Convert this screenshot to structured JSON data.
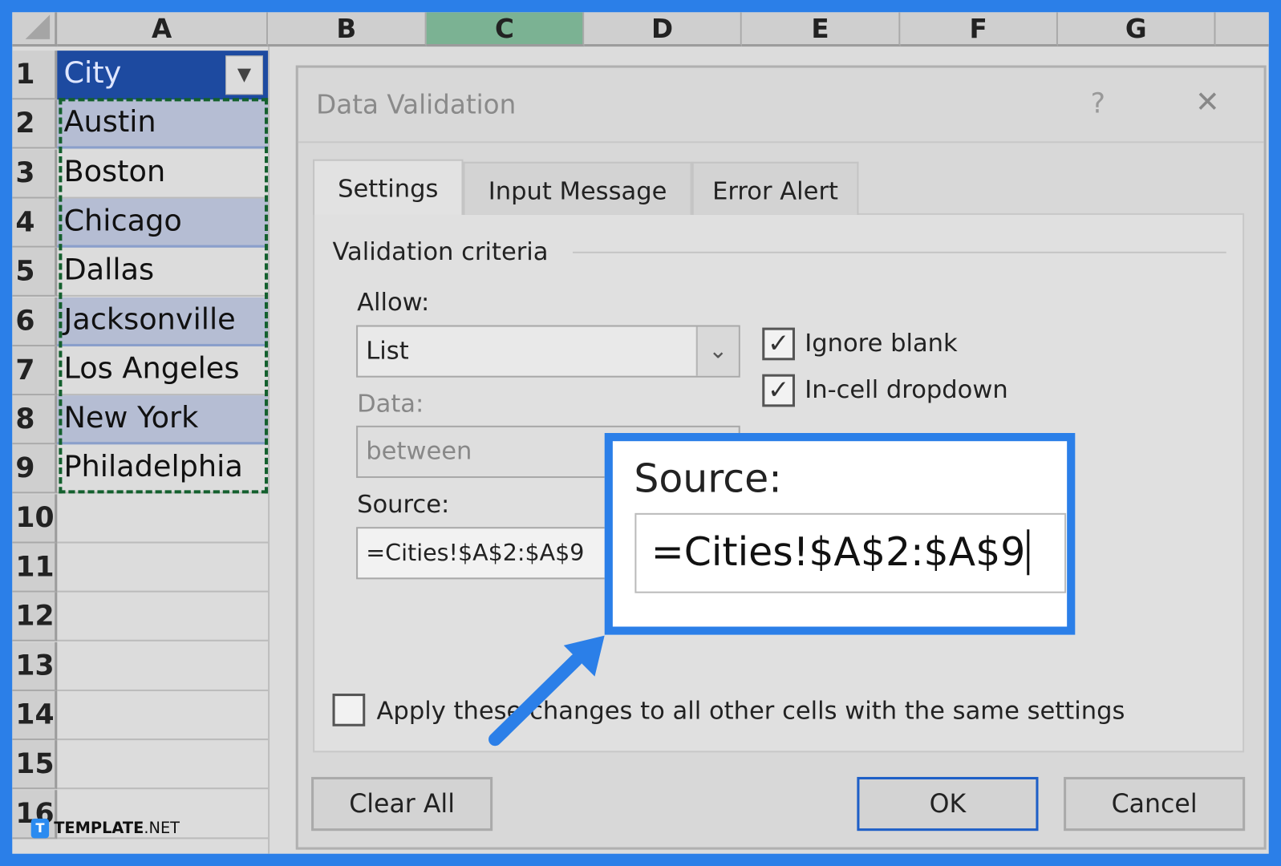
{
  "spreadsheet": {
    "columns": [
      "A",
      "B",
      "C",
      "D",
      "E",
      "F",
      "G"
    ],
    "selected_column": "C",
    "rows": [
      "1",
      "2",
      "3",
      "4",
      "5",
      "6",
      "7",
      "8",
      "9",
      "10",
      "11",
      "12",
      "13",
      "14",
      "15",
      "16"
    ],
    "header_cell": "City",
    "cities": [
      "Austin",
      "Boston",
      "Chicago",
      "Dallas",
      "Jacksonville",
      "Los Angeles",
      "New York",
      "Philadelphia"
    ]
  },
  "dialog": {
    "title": "Data Validation",
    "help": "?",
    "close": "✕",
    "tabs": [
      "Settings",
      "Input Message",
      "Error Alert"
    ],
    "active_tab": "Settings",
    "section": "Validation criteria",
    "allow_label": "Allow:",
    "allow_value": "List",
    "data_label": "Data:",
    "data_value": "between",
    "source_label": "Source:",
    "source_value": "=Cities!$A$2:$A$9",
    "ignore_blank": {
      "label": "Ignore blank",
      "checked": true
    },
    "in_cell_dropdown": {
      "label": "In-cell dropdown",
      "checked": true
    },
    "apply_all": {
      "label": "Apply these changes to all other cells with the same settings",
      "checked": false
    },
    "buttons": {
      "clear": "Clear All",
      "ok": "OK",
      "cancel": "Cancel"
    }
  },
  "callout": {
    "label": "Source:",
    "value": "=Cities!$A$2:$A$9",
    "color": "#2b7fe8"
  },
  "watermark": {
    "brand": "TEMPLATE",
    "suffix": ".NET"
  }
}
